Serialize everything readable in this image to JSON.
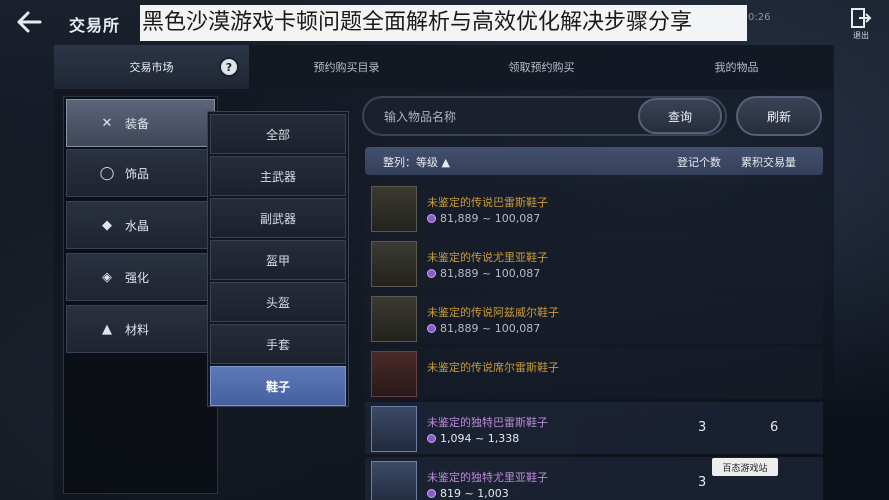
{
  "header": {
    "title": "交易所",
    "overlay_text": "黑色沙漠游戏卡顿问题全面解析与高效优化解决步骤分享",
    "clock": "0:26",
    "exit_label": "退出"
  },
  "tabs": [
    {
      "label": "交易市场",
      "active": true,
      "badge": "?"
    },
    {
      "label": "预约购买目录",
      "active": false
    },
    {
      "label": "领取预约购买",
      "active": false
    },
    {
      "label": "我的物品",
      "active": false
    }
  ],
  "categories": [
    {
      "label": "装备",
      "icon": "crossed-swords-icon",
      "active": true
    },
    {
      "label": "饰品",
      "icon": "ring-icon",
      "active": false
    },
    {
      "label": "水晶",
      "icon": "gem-icon",
      "active": false
    },
    {
      "label": "强化",
      "icon": "upgrade-icon",
      "active": false
    },
    {
      "label": "材料",
      "icon": "flask-icon",
      "active": false
    }
  ],
  "subcategories": [
    {
      "label": "全部",
      "active": false
    },
    {
      "label": "主武器",
      "active": false
    },
    {
      "label": "副武器",
      "active": false
    },
    {
      "label": "盔甲",
      "active": false
    },
    {
      "label": "头盔",
      "active": false
    },
    {
      "label": "手套",
      "active": false
    },
    {
      "label": "鞋子",
      "active": true
    }
  ],
  "search": {
    "placeholder": "输入物品名称",
    "query_label": "查询",
    "refresh_label": "刷新"
  },
  "list_header": {
    "sort_label": "整列：等级 ▲",
    "count_label": "登记个数",
    "volume_label": "累积交易量"
  },
  "items": [
    {
      "name": "未鉴定的传说巴雷斯鞋子",
      "price": "81,889 ~ 100,087",
      "rarity": "legend",
      "count": "",
      "volume": ""
    },
    {
      "name": "未鉴定的传说尤里亚鞋子",
      "price": "81,889 ~ 100,087",
      "rarity": "legend",
      "count": "",
      "volume": ""
    },
    {
      "name": "未鉴定的传说阿兹威尔鞋子",
      "price": "81,889 ~ 100,087",
      "rarity": "legend",
      "count": "",
      "volume": ""
    },
    {
      "name": "未鉴定的传说席尔雷斯鞋子",
      "price": "",
      "rarity": "legend",
      "count": "",
      "volume": ""
    },
    {
      "name": "未鉴定的独特巴雷斯鞋子",
      "price": "1,094 ~ 1,338",
      "rarity": "unique",
      "count": "3",
      "volume": "6"
    },
    {
      "name": "未鉴定的独特尤里亚鞋子",
      "price": "819 ~ 1,003",
      "rarity": "unique",
      "count": "3",
      "volume": ""
    }
  ],
  "watermark": "百态游戏站",
  "colors": {
    "legend_name": "#c99b3a",
    "unique_name": "#b98bd8",
    "active_sub": "#5f79b8",
    "coin": "#8a5cc8"
  }
}
